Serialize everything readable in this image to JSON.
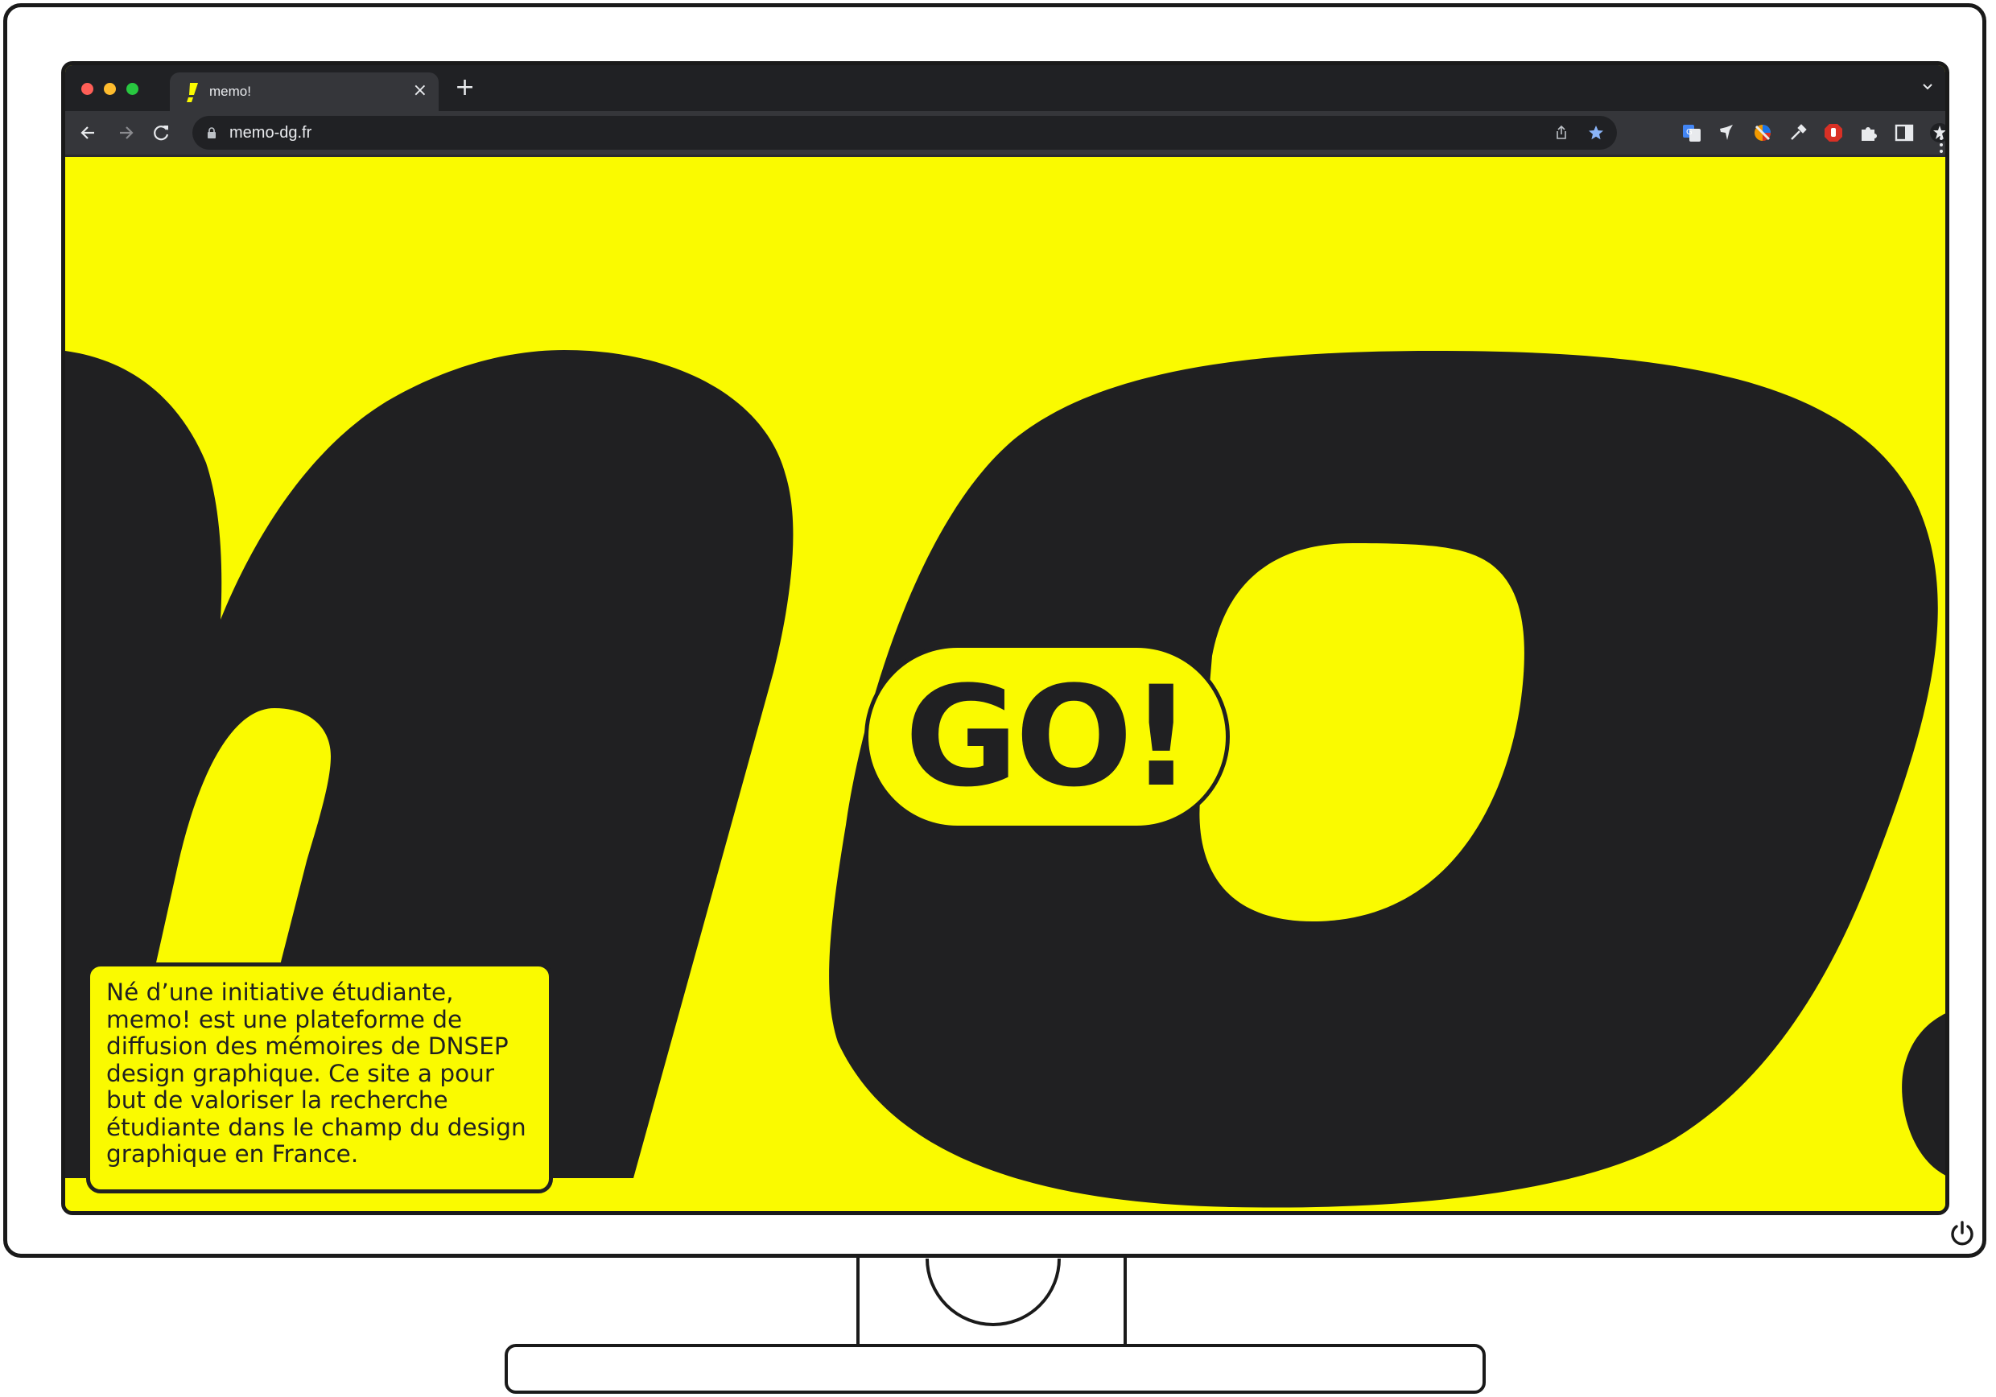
{
  "browser": {
    "tab": {
      "title": "memo!",
      "favicon": "memo-exclamation-icon",
      "close_label": "×"
    },
    "new_tab_label": "+",
    "address_bar": {
      "url": "memo-dg.fr",
      "secure": true
    },
    "window_controls": {
      "close": "#ff5f57",
      "minimize": "#febc2e",
      "maximize": "#28c840"
    },
    "extensions": [
      "google-translate-icon",
      "bird-extension-icon",
      "color-wheel-icon",
      "eyedropper-icon",
      "stop-hand-icon",
      "puzzle-extensions-icon",
      "side-panel-icon",
      "profile-star-icon",
      "kebab-menu-icon"
    ]
  },
  "page": {
    "background_color": "#fafa00",
    "ink_color": "#202022",
    "logo_letters": "me",
    "cta": {
      "label": "GO!"
    },
    "intro": "Né d’une initiative étudiante, memo! est une plateforme de diffusion des mémoires de DNSEP design graphique. Ce site a pour but de valoriser la recherche étudiante dans le champ du design graphique en France."
  },
  "device": {
    "frame": "monitor",
    "power_icon": "power-icon"
  }
}
